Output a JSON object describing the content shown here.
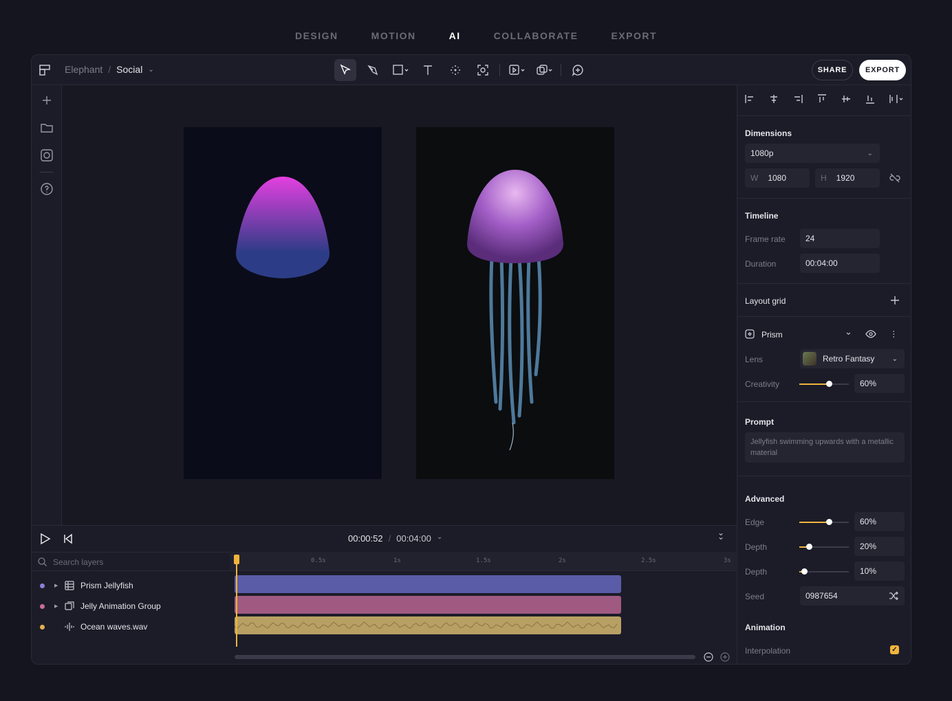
{
  "nav": {
    "tabs": [
      "DESIGN",
      "MOTION",
      "AI",
      "COLLABORATE",
      "EXPORT"
    ],
    "active": "AI"
  },
  "toolbar": {
    "project": "Elephant",
    "separator": "/",
    "file": "Social",
    "share": "SHARE",
    "export": "EXPORT"
  },
  "panel": {
    "dimensions": {
      "title": "Dimensions",
      "preset": "1080p",
      "w_label": "W",
      "w": "1080",
      "h_label": "H",
      "h": "1920"
    },
    "timeline": {
      "title": "Timeline",
      "frame_rate_label": "Frame rate",
      "frame_rate": "24",
      "duration_label": "Duration",
      "duration": "00:04:00"
    },
    "layout_grid": {
      "title": "Layout grid"
    },
    "prism": {
      "title": "Prism",
      "lens_label": "Lens",
      "lens": "Retro Fantasy",
      "creativity_label": "Creativity",
      "creativity": "60%",
      "creativity_level": 0.6
    },
    "prompt": {
      "title": "Prompt",
      "text": "Jellyfish swimming upwards with a metallic material"
    },
    "advanced": {
      "title": "Advanced",
      "edge_label": "Edge",
      "edge": "60%",
      "edge_level": 0.6,
      "depth_label": "Depth",
      "depth": "20%",
      "depth_level": 0.2,
      "depth2_label": "Depth",
      "depth2": "10%",
      "depth2_level": 0.1,
      "seed_label": "Seed",
      "seed": "0987654"
    },
    "animation": {
      "title": "Animation",
      "interp_label": "Interpolation",
      "interp": true
    }
  },
  "timeline": {
    "current": "00:00:52",
    "sep": "/",
    "total": "00:04:00",
    "search_placeholder": "Search layers",
    "ticks": [
      "0.5s",
      "1s",
      "1.5s",
      "2s",
      "2.5s",
      "3s"
    ],
    "layers": [
      {
        "name": "Prism Jellyfish",
        "dot": "#8b80d8"
      },
      {
        "name": "Jelly Animation Group",
        "dot": "#c86e96"
      },
      {
        "name": "Ocean waves.wav",
        "dot": "#e0b050"
      }
    ]
  },
  "colors": {
    "clip1": "#5a5ca8",
    "clip2": "#a05a82",
    "clip3": "#b8a064",
    "accent": "#f0b43c"
  }
}
